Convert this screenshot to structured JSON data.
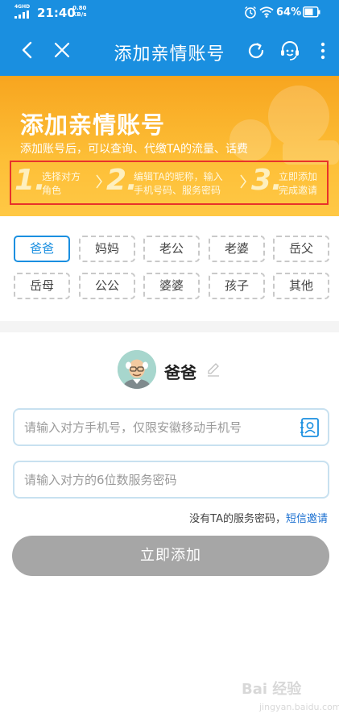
{
  "status_bar": {
    "network": "4GHD",
    "time": "21:40",
    "speed_value": "0.80",
    "speed_unit": "KB/s",
    "battery_percent": "64%"
  },
  "title_bar": {
    "title": "添加亲情账号",
    "icons": [
      "back-icon",
      "close-icon",
      "refresh-icon",
      "customer-service-icon",
      "more-icon"
    ]
  },
  "banner": {
    "title": "添加亲情账号",
    "subtitle": "添加账号后，可以查询、代缴TA的流量、话费",
    "steps": [
      {
        "num": "1.",
        "line1": "选择对方",
        "line2": "角色"
      },
      {
        "num": "2.",
        "line1": "编辑TA的昵称，输入",
        "line2": "手机号码、服务密码"
      },
      {
        "num": "3.",
        "line1": "立即添加",
        "line2": "完成邀请"
      }
    ]
  },
  "relations": {
    "selected": "爸爸",
    "items": [
      "爸爸",
      "妈妈",
      "老公",
      "老婆",
      "岳父",
      "岳母",
      "公公",
      "婆婆",
      "孩子",
      "其他"
    ]
  },
  "form": {
    "relation_name": "爸爸",
    "phone_placeholder": "请输入对方手机号，仅限安徽移动手机号",
    "password_placeholder": "请输入对方的6位数服务密码",
    "hint_text": "没有TA的服务密码，",
    "hint_link": "短信邀请",
    "submit_label": "立即添加"
  },
  "watermark": {
    "text": "Bai 经验",
    "sub": "jingyan.baidu.com"
  },
  "colors": {
    "primary_blue": "#1a8fe0",
    "banner_orange": "#fdbf37",
    "highlight_red": "#e8322b",
    "button_gray": "#a6a6a6"
  }
}
